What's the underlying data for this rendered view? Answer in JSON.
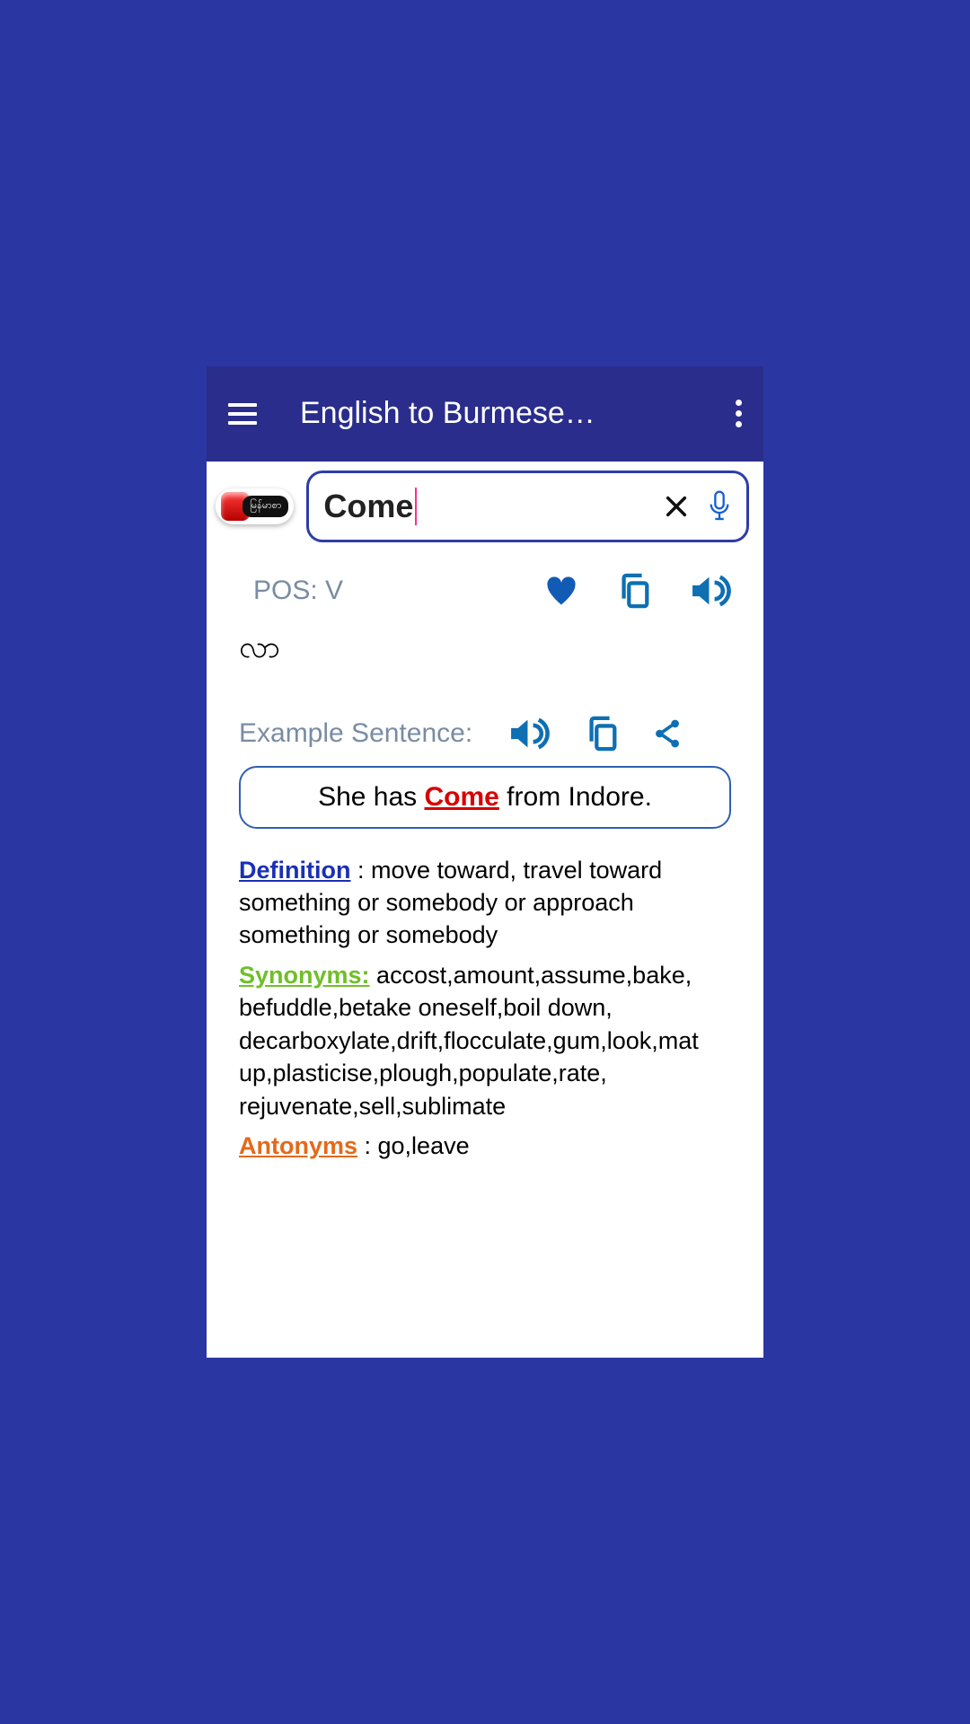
{
  "appbar": {
    "title": "English to Burmese…"
  },
  "search": {
    "value": "Come",
    "lang_toggle": "မြန်မာစာ"
  },
  "pos": {
    "label": "POS: V"
  },
  "translation": "လာ",
  "example": {
    "label": "Example Sentence:",
    "before": "She has ",
    "highlight": "Come",
    "after": " from Indore."
  },
  "definition": {
    "label": "Definition",
    "text": " : move toward, travel toward something or somebody or approach something or somebody"
  },
  "synonyms": {
    "label": "Synonyms:",
    "text": " accost,amount,assume,bake, befuddle,betake oneself,boil down, decarboxylate,drift,flocculate,gum,look,mat up,plasticise,plough,populate,rate, rejuvenate,sell,sublimate"
  },
  "antonyms": {
    "label": "Antonyms",
    "text": " : go,leave"
  }
}
